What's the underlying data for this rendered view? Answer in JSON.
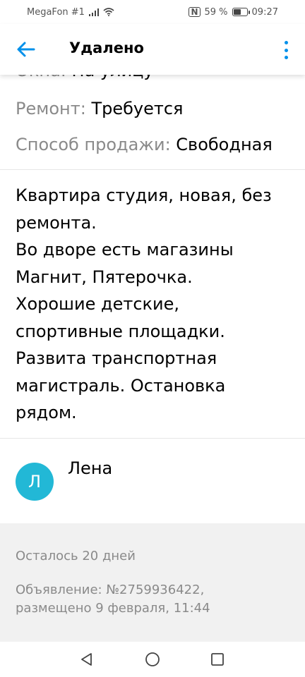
{
  "status_bar": {
    "carrier": "MegaFon #1",
    "battery_percent": "59 %",
    "battery_level": 0.59,
    "time": "09:27"
  },
  "app_bar": {
    "title": "Удалено",
    "back_icon": "arrow-left-icon",
    "menu_icon": "more-vertical-icon",
    "accent": "#0090ea"
  },
  "params": [
    {
      "key": "Окна:",
      "value": "На улицу"
    },
    {
      "key": "Ремонт:",
      "value": "Требуется"
    },
    {
      "key": "Способ продажи:",
      "value": "Свободная"
    }
  ],
  "description": [
    "Квартира студия, новая, без",
    "ремонта.",
    "Во дворе есть магазины",
    "Магнит, Пятерочка.",
    "Хорошие детские,",
    "спортивные площадки.",
    "Развита транспортная",
    "магистраль. Остановка",
    "рядом."
  ],
  "seller": {
    "avatar_letter": "Л",
    "name": "Лена",
    "avatar_color": "#22b8d6"
  },
  "footer": {
    "remaining": "Осталось 20 дней",
    "ad_line1": "Объявление: №2759936422,",
    "ad_line2": "размещено 9 февраля, 11:44"
  },
  "nav": {
    "back_icon": "triangle-back-icon",
    "home_icon": "circle-home-icon",
    "recent_icon": "square-recent-icon"
  }
}
